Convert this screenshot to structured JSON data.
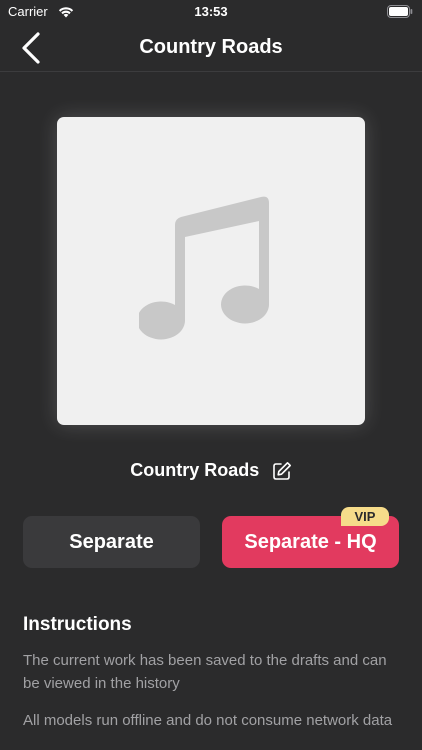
{
  "status_bar": {
    "carrier": "Carrier",
    "time": "13:53"
  },
  "nav": {
    "title": "Country Roads"
  },
  "song": {
    "title": "Country Roads"
  },
  "buttons": {
    "separate": "Separate",
    "separate_hq": "Separate - HQ",
    "vip_badge": "VIP"
  },
  "instructions": {
    "title": "Instructions",
    "items": [
      "The current work has been saved to the drafts and can be viewed in the history",
      "All models run offline and do not consume network data"
    ]
  },
  "colors": {
    "background": "#2b2b2c",
    "accent": "#e23a5f",
    "vip": "#f6dc8a",
    "secondary_button": "#3a3a3c"
  }
}
